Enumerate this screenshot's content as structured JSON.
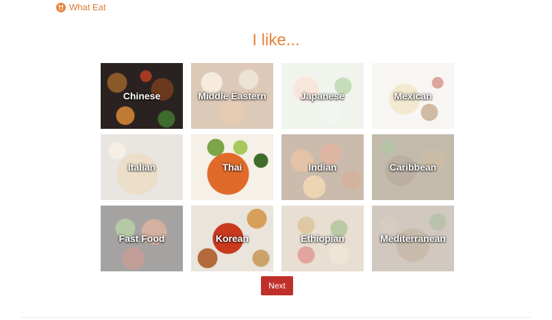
{
  "brand": {
    "name": "What Eat",
    "logo_icon": "fork-spoon-icon",
    "accent_color": "#e8823a"
  },
  "heading": "I like...",
  "cuisines": [
    {
      "label": "Chinese",
      "selected": true
    },
    {
      "label": "Middle Eastern",
      "selected": false
    },
    {
      "label": "Japanese",
      "selected": false
    },
    {
      "label": "Mexican",
      "selected": false
    },
    {
      "label": "Italian",
      "selected": false
    },
    {
      "label": "Thai",
      "selected": true
    },
    {
      "label": "Indian",
      "selected": false
    },
    {
      "label": "Caribbean",
      "selected": false
    },
    {
      "label": "Fast Food",
      "selected": false
    },
    {
      "label": "Korean",
      "selected": true
    },
    {
      "label": "Ethiopian",
      "selected": false
    },
    {
      "label": "Mediterranean",
      "selected": false
    }
  ],
  "next_button": {
    "label": "Next",
    "color": "#c0302a"
  }
}
